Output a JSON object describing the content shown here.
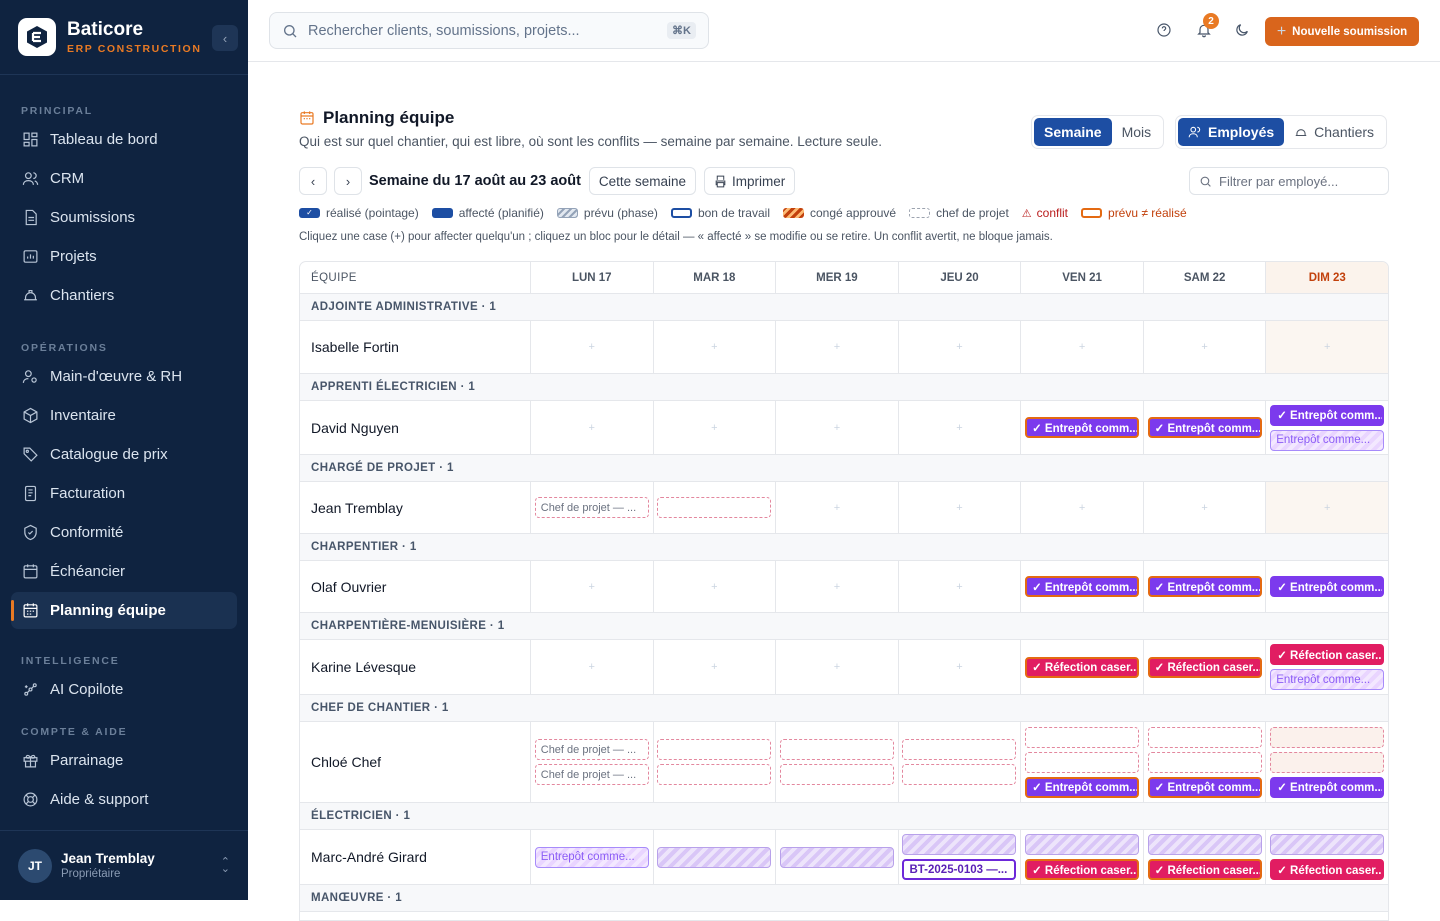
{
  "brand": {
    "name": "Baticore",
    "sub": "ERP CONSTRUCTION"
  },
  "nav": {
    "sections": [
      {
        "title": "PRINCIPAL",
        "items": [
          "Tableau de bord",
          "CRM",
          "Soumissions",
          "Projets",
          "Chantiers"
        ]
      },
      {
        "title": "OPÉRATIONS",
        "items": [
          "Main-d'œuvre & RH",
          "Inventaire",
          "Catalogue de prix",
          "Facturation",
          "Conformité",
          "Échéancier",
          "Planning équipe"
        ]
      },
      {
        "title": "INTELLIGENCE",
        "items": [
          "AI Copilote"
        ]
      },
      {
        "title": "COMPTE & AIDE",
        "items": [
          "Parrainage",
          "Aide & support"
        ]
      }
    ],
    "active": "Planning équipe"
  },
  "user": {
    "initials": "JT",
    "name": "Jean Tremblay",
    "role": "Propriétaire"
  },
  "topbar": {
    "search_placeholder": "Rechercher clients, soumissions, projets...",
    "shortcut": "⌘K",
    "notif_count": "2",
    "new_button": "Nouvelle soumission"
  },
  "page": {
    "title": "Planning équipe",
    "subtitle": "Qui est sur quel chantier, qui est libre, où sont les conflits — semaine par semaine. Lecture seule.",
    "view_toggle": [
      "Semaine",
      "Mois"
    ],
    "mode_toggle": [
      "Employés",
      "Chantiers"
    ],
    "week_label": "Semaine du 17 août au 23 août",
    "this_week": "Cette semaine",
    "print": "Imprimer",
    "filter_placeholder": "Filtrer par employé...",
    "legend": [
      "réalisé (pointage)",
      "affecté (planifié)",
      "prévu (phase)",
      "bon de travail",
      "congé approuvé",
      "chef de projet",
      "conflit",
      "prévu ≠ réalisé"
    ],
    "hint": "Cliquez une case (+) pour affecter quelqu'un ; cliquez un bloc pour le détail — « affecté » se modifie ou se retire. Un conflit avertit, ne bloque jamais."
  },
  "grid": {
    "header": [
      "ÉQUIPE",
      "LUN 17",
      "MAR 18",
      "MER 19",
      "JEU 20",
      "VEN 21",
      "SAM 22",
      "DIM 23"
    ],
    "groups": [
      {
        "label": "ADJOINTE ADMINISTRATIVE · 1",
        "employee": "Isabelle Fortin"
      },
      {
        "label": "APPRENTI ÉLECTRICIEN · 1",
        "employee": "David Nguyen"
      },
      {
        "label": "CHARGÉ DE PROJET · 1",
        "employee": "Jean Tremblay"
      },
      {
        "label": "CHARPENTIER · 1",
        "employee": "Olaf Ouvrier"
      },
      {
        "label": "CHARPENTIÈRE-MENUISIÈRE · 1",
        "employee": "Karine Lévesque"
      },
      {
        "label": "CHEF DE CHANTIER · 1",
        "employee": "Chloé Chef"
      },
      {
        "label": "ÉLECTRICIEN · 1",
        "employee": "Marc-André Girard"
      },
      {
        "label": "MANŒUVRE · 1",
        "employee": ""
      }
    ],
    "blocks": {
      "entrepot_real": "✓ Entrepôt comm...",
      "entrepot_phase": "Entrepôt comme...",
      "refection_real": "✓ Réfection caser...",
      "chef": "Chef de projet — ...",
      "bt": "BT-2025-0103 —...",
      "empty": "+"
    }
  }
}
